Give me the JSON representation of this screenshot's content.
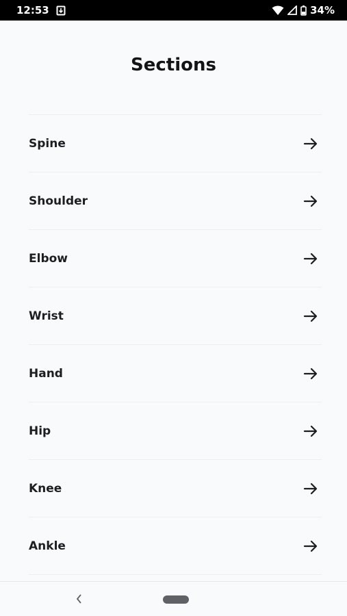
{
  "status_bar": {
    "time": "12:53",
    "battery": "34%",
    "icons": [
      "download-notification-icon",
      "wifi-icon",
      "signal-icon",
      "battery-icon"
    ]
  },
  "page": {
    "title": "Sections"
  },
  "sections": [
    {
      "label": "Spine"
    },
    {
      "label": "Shoulder"
    },
    {
      "label": "Elbow"
    },
    {
      "label": "Wrist"
    },
    {
      "label": "Hand"
    },
    {
      "label": "Hip"
    },
    {
      "label": "Knee"
    },
    {
      "label": "Ankle"
    }
  ],
  "item_icon": "arrow-right-icon",
  "nav_bar": {
    "icons": [
      "back-icon",
      "home-pill-icon"
    ]
  }
}
